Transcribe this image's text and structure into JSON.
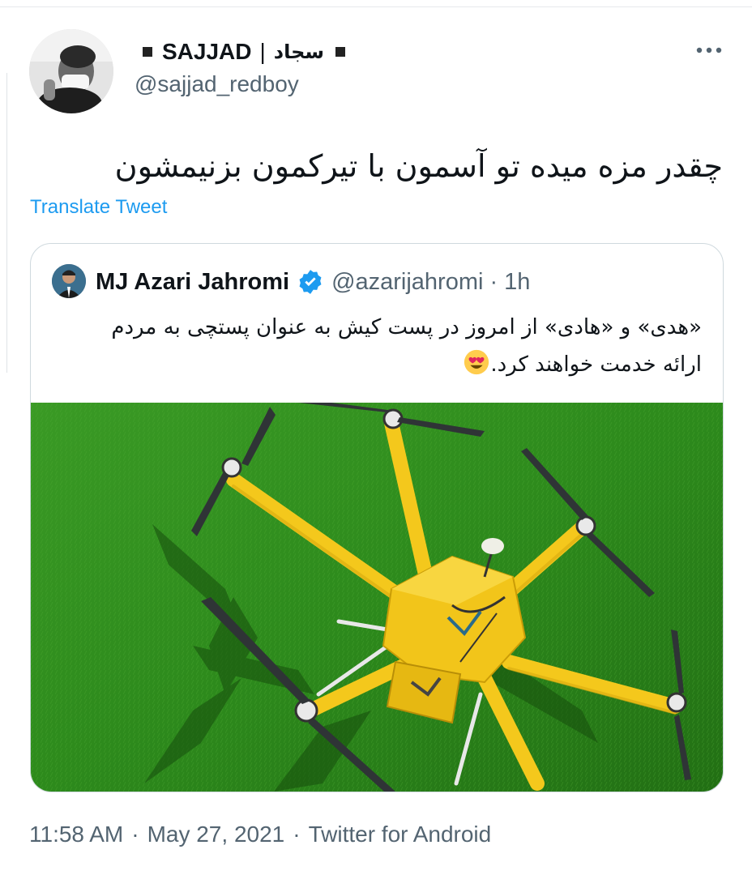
{
  "author": {
    "display_name_en": "SAJJAD",
    "display_name_sep": "|",
    "display_name_fa": "سجاد",
    "handle": "@sajjad_redboy"
  },
  "tweet": {
    "text": "چقدر مزه میده تو آسمون با تیرکمون بزنیمشون",
    "translate_label": "Translate Tweet"
  },
  "quote": {
    "display_name": "MJ Azari Jahromi",
    "handle": "@azarijahromi",
    "dot": "·",
    "time": "1h",
    "text": "«هدی» و «هادی» از امروز در پست کیش به عنوان پستچی به مردم ارائه خدمت خواهند کرد."
  },
  "meta": {
    "time": "11:58 AM",
    "date": "May 27, 2021",
    "source": "Twitter for Android",
    "sep": "·"
  },
  "icons": {
    "more": "more-horizontal-icon",
    "verified": "verified-badge-icon",
    "emoji": "heart-eyes-emoji"
  },
  "colors": {
    "link": "#1d9bf0",
    "secondary_text": "#536471",
    "verified": "#1d9bf0",
    "drone_yellow": "#f4c81c",
    "grass": "#2f8a1f"
  }
}
